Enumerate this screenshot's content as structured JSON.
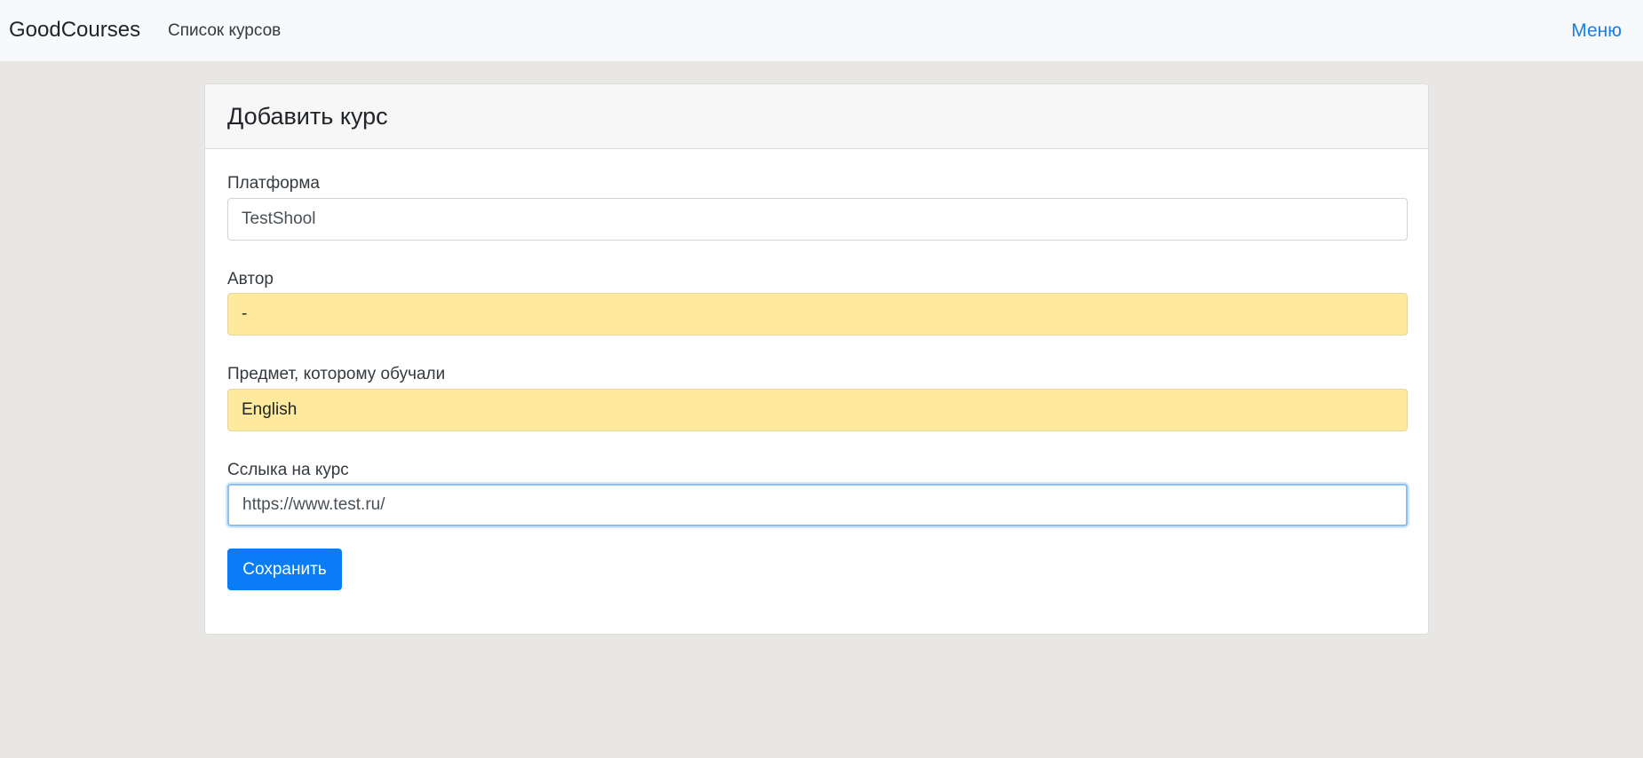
{
  "navbar": {
    "brand": "GoodCourses",
    "courses_link": "Список курсов",
    "menu_link": "Меню"
  },
  "form": {
    "title": "Добавить курс",
    "fields": [
      {
        "label": "Платформа",
        "value": "TestShool",
        "state": "normal"
      },
      {
        "label": "Автор",
        "value": "-",
        "state": "autofilled"
      },
      {
        "label": "Предмет, которому обучали",
        "value": "English",
        "state": "autofilled"
      },
      {
        "label": "Сслыка на курс",
        "value": "https://www.test.ru/",
        "state": "focused"
      }
    ],
    "submit_label": "Сохранить"
  },
  "colors": {
    "navbar_bg": "#f8f9fa",
    "page_bg": "#e9e7e4",
    "link": "#1a7fe6",
    "primary_button": "#0a7cf6",
    "autofill_bg": "#fee99c"
  }
}
